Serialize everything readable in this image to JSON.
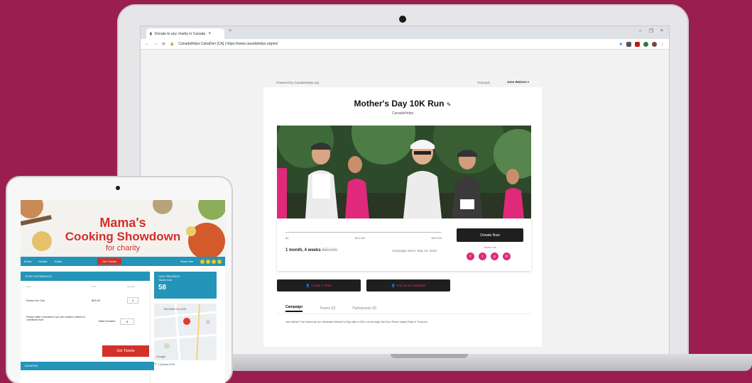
{
  "browser": {
    "tab_title": "Donate to any charity in Canada",
    "tab_close": "×",
    "new_tab": "+",
    "controls": {
      "minimize": "–",
      "maximize": "❐",
      "close": "×"
    },
    "nav": {
      "back": "←",
      "forward": "→",
      "reload": "⟳",
      "lock": "🔒"
    },
    "url": "CanadaHelps CanaDon [CA] | https://www.canadahelps.org/en/"
  },
  "page_header": {
    "powered_by": "Powered by CanadaHelps.org",
    "language": "Français",
    "user_name": "Jane Watson",
    "user_caret": "▾"
  },
  "campaign": {
    "title": "Mother's Day 10K Run",
    "edit_icon": "✎",
    "organizer": "CanadaHelps"
  },
  "progress": {
    "ticks": [
      "$0",
      "$25,000",
      "$50,000"
    ],
    "raised_text": "1 month, 4 weeks",
    "goal_text": "$50,000",
    "started": "Campaign Since: May 12, 2019"
  },
  "actions": {
    "donate": "Donate Now",
    "share_label": "Share Via",
    "share_icons": [
      "f",
      "t",
      "p",
      "✉"
    ],
    "create_team": "Create a Team",
    "join_individual": "Join as an Individual"
  },
  "tabs": [
    "Campaign",
    "Teams (0)",
    "Participants (0)"
  ],
  "description": "Join Better The World as we celebrate Mother's Day with a 10K run through the Don River Valley Park in Toronto!",
  "tablet": {
    "banner": {
      "line1": "Mama's",
      "line2": "Cooking Showdown",
      "line3": "for charity"
    },
    "nav": {
      "items": [
        "Event",
        "Details",
        "Goals"
      ],
      "get_tickets": "Get Tickets",
      "share": "Share this"
    },
    "form": {
      "header": "TICKET INFORMATION",
      "col_type": "Type",
      "col_price": "Price",
      "col_qty": "Quantity",
      "row1_type": "Dinner for One",
      "row1_price": "$25.00",
      "row1_qty": "0",
      "note": "Please make a donation if you are unable to attend or contribute more.",
      "donation_label": "Make Donation",
      "donation_value": "$",
      "button": "Get Tickets",
      "footer": "DONATION"
    },
    "goal": {
      "label": "GOAL PROGRESS",
      "sub": "Tickets Sold",
      "value": "58"
    },
    "map": {
      "area": "BALDWIN VILLAGE",
      "google": "Google"
    },
    "address": "1 Queens St W"
  },
  "colors": {
    "background": "#9a1f4e",
    "accent_pink": "#e0297a",
    "tablet_red": "#d3302a",
    "tablet_blue": "#2494b8"
  }
}
